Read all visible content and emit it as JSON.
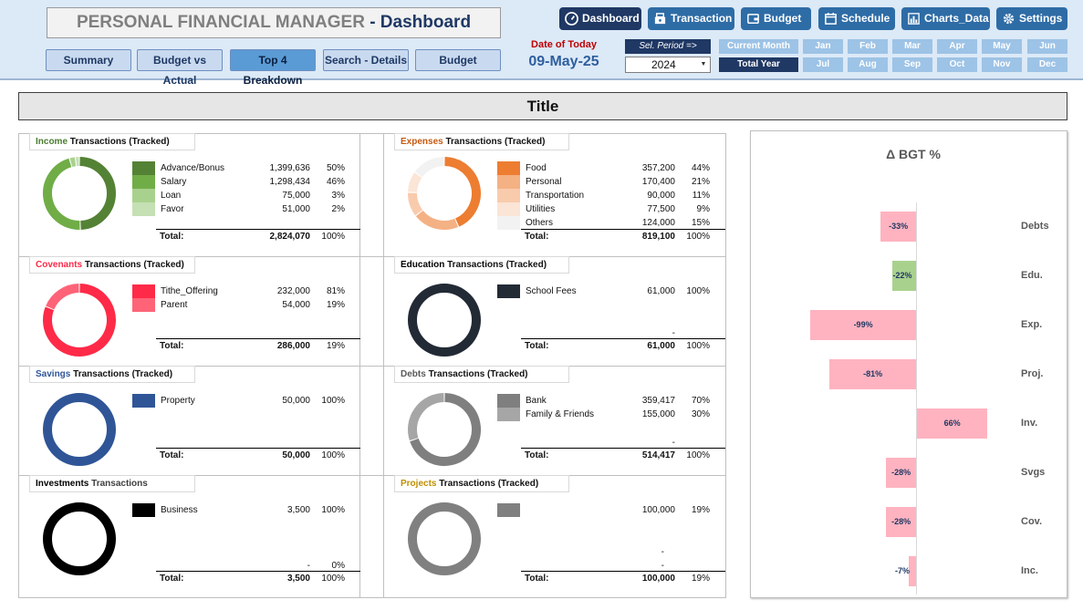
{
  "header": {
    "title_main": "PERSONAL FINANCIAL MANAGER",
    "title_sub": "- Dashboard",
    "tabs": [
      "Summary",
      "Budget vs Actual",
      "Top 4 Breakdown",
      "Search - Details",
      "Budget"
    ],
    "active_tab": "Top 4 Breakdown",
    "today_label": "Date of Today",
    "today_value": "09-May-25",
    "top_buttons": [
      "Dashboard",
      "Transaction",
      "Budget",
      "Schedule",
      "Charts_Data",
      "Settings"
    ],
    "sel_period_label": "Sel. Period =>",
    "year": "2024",
    "period_current": "Current Month",
    "period_total": "Total Year",
    "months_row1": [
      "Jan",
      "Feb",
      "Mar",
      "Apr",
      "May",
      "Jun"
    ],
    "months_row2": [
      "Jul",
      "Aug",
      "Sep",
      "Oct",
      "Nov",
      "Dec"
    ]
  },
  "page_title": "Title",
  "panels": {
    "income": {
      "title_colored": "Income",
      "title_rest": " Transactions (Tracked)",
      "title_color": "#4a7c2f",
      "items": [
        {
          "label": "Advance/Bonus",
          "amount": "1,399,636",
          "pct": "50%",
          "color": "#548235"
        },
        {
          "label": "Salary",
          "amount": "1,298,434",
          "pct": "46%",
          "color": "#70ad47"
        },
        {
          "label": "Loan",
          "amount": "75,000",
          "pct": "3%",
          "color": "#a9d18e"
        },
        {
          "label": "Favor",
          "amount": "51,000",
          "pct": "2%",
          "color": "#c5e0b4"
        }
      ],
      "total_label": "Total:",
      "total_amount": "2,824,070",
      "total_pct": "100%"
    },
    "expenses": {
      "title_colored": "Expenses",
      "title_rest": " Transactions (Tracked)",
      "title_color": "#c55a11",
      "items": [
        {
          "label": "Food",
          "amount": "357,200",
          "pct": "44%",
          "color": "#ed7d31"
        },
        {
          "label": "Personal",
          "amount": "170,400",
          "pct": "21%",
          "color": "#f4b183"
        },
        {
          "label": "Transportation",
          "amount": "90,000",
          "pct": "11%",
          "color": "#f8cbad"
        },
        {
          "label": "Utilities",
          "amount": "77,500",
          "pct": "9%",
          "color": "#fbe5d6"
        },
        {
          "label": "Others",
          "amount": "124,000",
          "pct": "15%",
          "color": "#f2f2f2"
        }
      ],
      "total_label": "Total:",
      "total_amount": "819,100",
      "total_pct": "100%"
    },
    "covenants": {
      "title_colored": "Covenants",
      "title_rest": " Transactions (Tracked)",
      "title_color": "#ff2a48",
      "items": [
        {
          "label": "Tithe_Offering",
          "amount": "232,000",
          "pct": "81%",
          "color": "#ff2a48"
        },
        {
          "label": "Parent",
          "amount": "54,000",
          "pct": "19%",
          "color": "#ff6378"
        }
      ],
      "total_label": "Total:",
      "total_amount": "286,000",
      "total_pct": "19%"
    },
    "education": {
      "title_colored": "Education",
      "title_rest": " Transactions (Tracked)",
      "title_color": "#000000",
      "items": [
        {
          "label": "School Fees",
          "amount": "61,000",
          "pct": "100%",
          "color": "#222a35"
        }
      ],
      "extra_dash": "-",
      "total_label": "Total:",
      "total_amount": "61,000",
      "total_pct": "100%"
    },
    "savings": {
      "title_colored": "Savings",
      "title_rest": " Transactions (Tracked)",
      "title_color": "#2f5597",
      "items": [
        {
          "label": "Property",
          "amount": "50,000",
          "pct": "100%",
          "color": "#2f5597"
        }
      ],
      "total_label": "Total:",
      "total_amount": "50,000",
      "total_pct": "100%"
    },
    "debts": {
      "title_colored": "Debts",
      "title_rest": " Transactions (Tracked)",
      "title_color": "#595959",
      "items": [
        {
          "label": "Bank",
          "amount": "359,417",
          "pct": "70%",
          "color": "#7f7f7f"
        },
        {
          "label": "Family & Friends",
          "amount": "155,000",
          "pct": "30%",
          "color": "#a6a6a6"
        }
      ],
      "extra_dash": "-",
      "total_label": "Total:",
      "total_amount": "514,417",
      "total_pct": "100%"
    },
    "investments": {
      "title_colored": "Investments",
      "title_rest": " Transactions",
      "title_color": "#000000",
      "title_rest_color": "#404040",
      "items": [
        {
          "label": "Business",
          "amount": "3,500",
          "pct": "100%",
          "color": "#000000"
        }
      ],
      "extra_dash": "-",
      "extra_pct": "0%",
      "total_label": "Total:",
      "total_amount": "3,500",
      "total_pct": "100%"
    },
    "projects": {
      "title_colored": "Projects",
      "title_rest": " Transactions (Tracked)",
      "title_color": "#bf9000",
      "items": [
        {
          "label": "",
          "amount": "100,000",
          "pct": "19%",
          "color": "#808080"
        }
      ],
      "extra_dash1": "-",
      "extra_dash2": "-",
      "total_label": "Total:",
      "total_amount": "100,000",
      "total_pct": "19%"
    }
  },
  "chart_data": {
    "type": "bar",
    "orientation": "horizontal",
    "title": "Δ BGT %",
    "categories": [
      "Debts",
      "Edu.",
      "Exp.",
      "Proj.",
      "Inv.",
      "Svgs",
      "Cov.",
      "Inc."
    ],
    "values": [
      -33,
      -22,
      -99,
      -81,
      66,
      -28,
      -28,
      -7
    ],
    "labels": [
      "-33%",
      "-22%",
      "-99%",
      "-81%",
      "66%",
      "-28%",
      "-28%",
      "-7%"
    ],
    "colors": [
      "#ffb3c0",
      "#a9d18e",
      "#ffb3c0",
      "#ffb3c0",
      "#ffb3c0",
      "#ffb3c0",
      "#ffb3c0",
      "#ffb3c0"
    ],
    "xlim": [
      -100,
      100
    ]
  }
}
